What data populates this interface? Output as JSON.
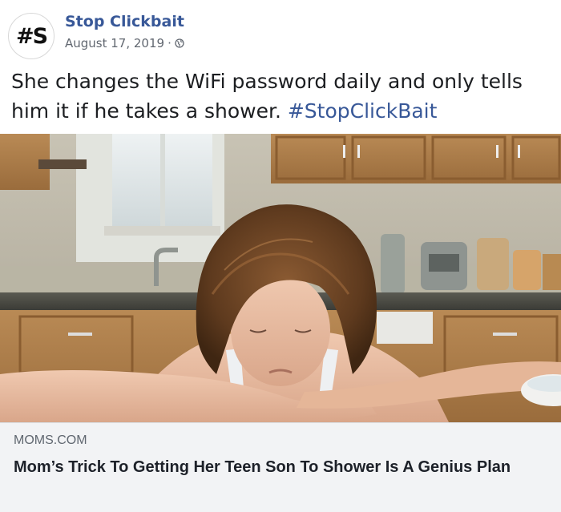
{
  "post": {
    "page_name": "Stop Clickbait",
    "avatar_text": "#S",
    "date": "August 17, 2019",
    "separator": "·",
    "privacy_icon": "globe-icon",
    "text_main": "She changes the WiFi password daily and only tells him it if he takes a shower.",
    "hashtag": "#StopClickBait",
    "link_color": "#385898"
  },
  "preview": {
    "source": "MOMS.COM",
    "headline": "Mom’s Trick To Getting Her Teen Son To Shower Is A Genius Plan"
  }
}
